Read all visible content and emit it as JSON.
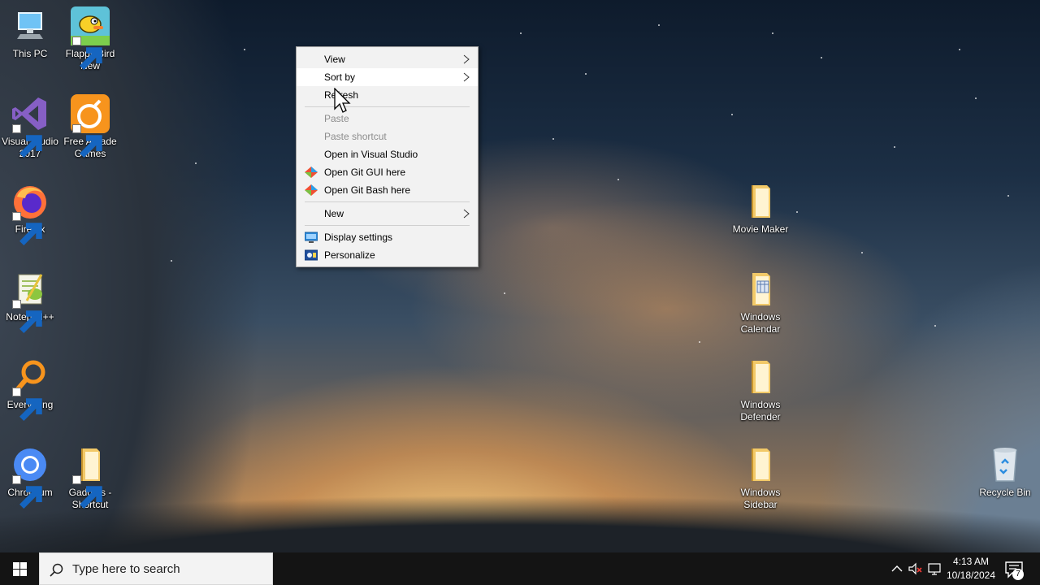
{
  "desktop": {
    "icons": [
      {
        "label": "This PC",
        "icon": "computer-icon"
      },
      {
        "label": "Flappy Bird New",
        "icon": "flappy-bird-icon"
      },
      {
        "label": "Visual Studio 2017",
        "icon": "visual-studio-icon"
      },
      {
        "label": "Free Arcade Games",
        "icon": "arcade-icon"
      },
      {
        "label": "Firefox",
        "icon": "firefox-icon"
      },
      {
        "label": "Notepad++",
        "icon": "notepadpp-icon"
      },
      {
        "label": "Everything",
        "icon": "everything-search-icon"
      },
      {
        "label": "Chromium",
        "icon": "chromium-icon"
      },
      {
        "label": "Gadgets - Shortcut",
        "icon": "folder-icon"
      },
      {
        "label": "Movie Maker",
        "icon": "folder-icon"
      },
      {
        "label": "Windows Calendar",
        "icon": "folder-icon"
      },
      {
        "label": "Windows Defender",
        "icon": "folder-icon"
      },
      {
        "label": "Windows Sidebar",
        "icon": "folder-icon"
      },
      {
        "label": "Recycle Bin",
        "icon": "recycle-bin-icon"
      }
    ]
  },
  "context_menu": {
    "items": [
      {
        "label": "View",
        "submenu": true
      },
      {
        "label": "Sort by",
        "submenu": true,
        "highlighted": true
      },
      {
        "label": "Refresh"
      },
      {
        "label": "Paste",
        "disabled": true
      },
      {
        "label": "Paste shortcut",
        "disabled": true
      },
      {
        "label": "Open in Visual Studio"
      },
      {
        "label": "Open Git GUI here",
        "icon": "git-icon"
      },
      {
        "label": "Open Git Bash here",
        "icon": "git-icon"
      },
      {
        "label": "New",
        "submenu": true
      },
      {
        "label": "Display settings",
        "icon": "display-icon"
      },
      {
        "label": "Personalize",
        "icon": "personalize-icon"
      }
    ]
  },
  "taskbar": {
    "search_placeholder": "Type here to search",
    "time": "4:13 AM",
    "date": "10/18/2024",
    "notification_count": "7"
  },
  "colors": {
    "taskbar": "#141414",
    "menu_bg": "#f2f2f2",
    "menu_hover": "#ffffff",
    "disabled_text": "#8d8d8d"
  }
}
